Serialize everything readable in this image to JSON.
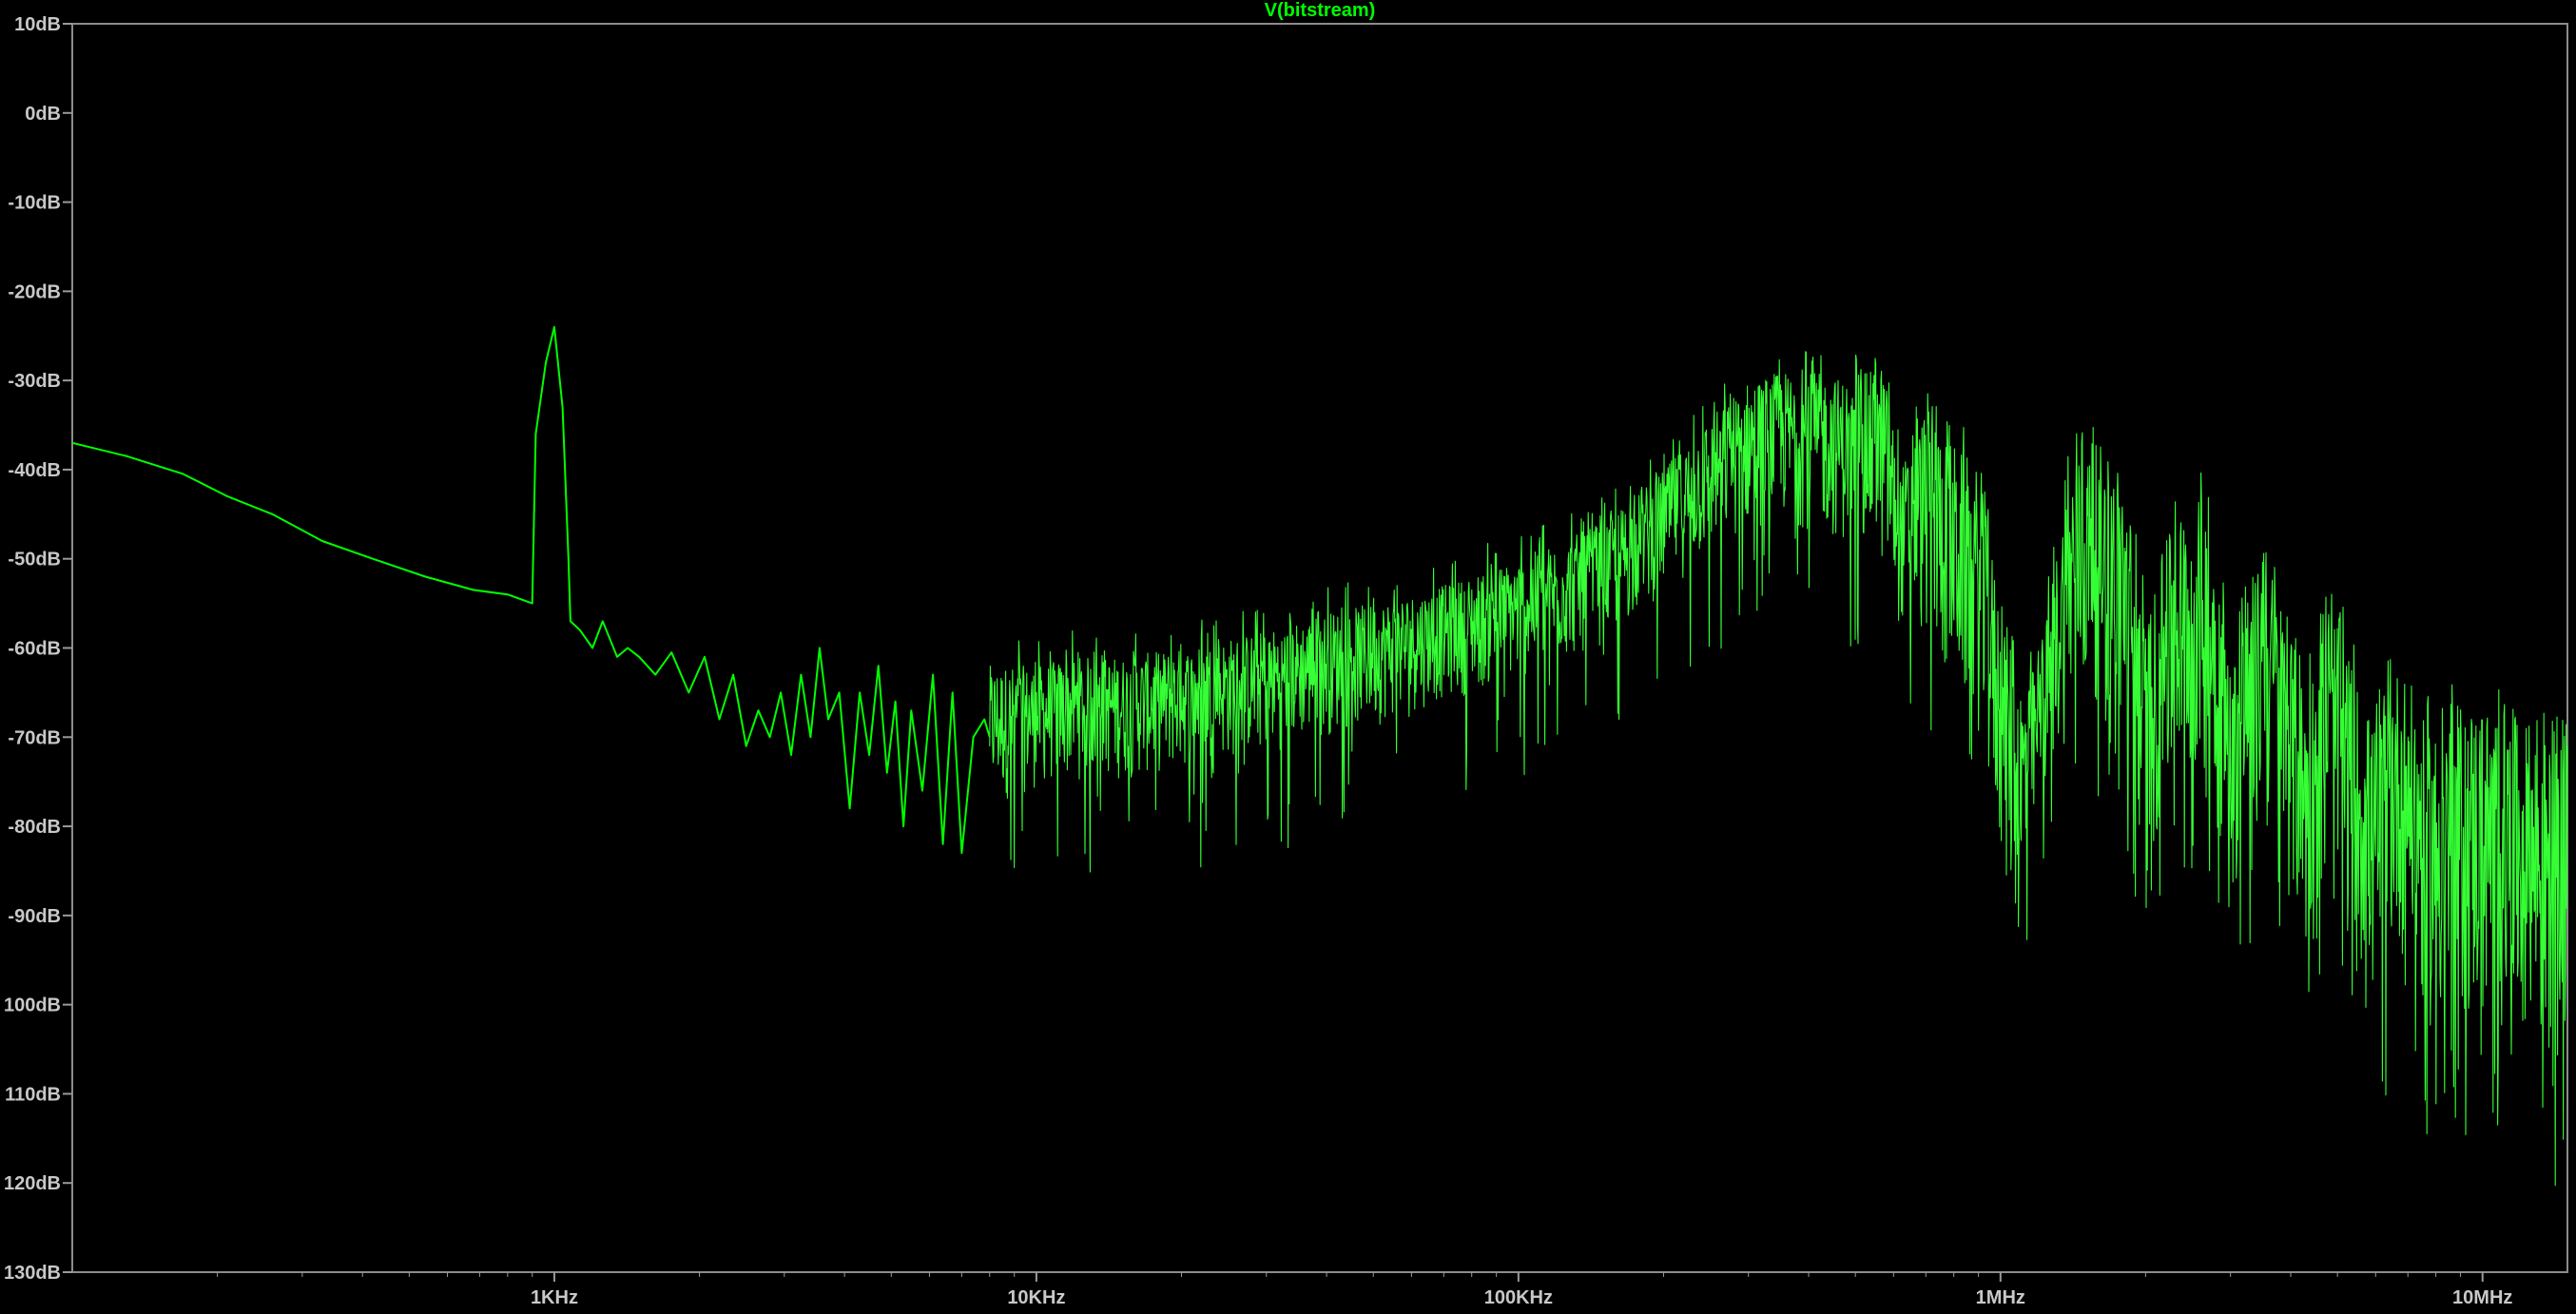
{
  "colors": {
    "background": "#000000",
    "frame": "#8c8c8c",
    "ticks": "#9a9a9a",
    "labels": "#c8c8c8",
    "trace": "#00ff00",
    "trace_fill": "#35ff35"
  },
  "chart_data": {
    "type": "line",
    "title": "V(bitstream)",
    "xlabel": "",
    "ylabel": "",
    "x_scale": "log",
    "xlim": [
      100,
      15000000
    ],
    "ylim": [
      -130,
      10
    ],
    "grid": false,
    "x_ticks": [
      {
        "value": 1000,
        "label": "1KHz"
      },
      {
        "value": 10000,
        "label": "10KHz"
      },
      {
        "value": 100000,
        "label": "100KHz"
      },
      {
        "value": 1000000,
        "label": "1MHz"
      },
      {
        "value": 10000000,
        "label": "10MHz"
      }
    ],
    "y_ticks": [
      {
        "value": 10,
        "label": "10dB"
      },
      {
        "value": 0,
        "label": "0dB"
      },
      {
        "value": -10,
        "label": "-10dB"
      },
      {
        "value": -20,
        "label": "-20dB"
      },
      {
        "value": -30,
        "label": "-30dB"
      },
      {
        "value": -40,
        "label": "-40dB"
      },
      {
        "value": -50,
        "label": "-50dB"
      },
      {
        "value": -60,
        "label": "-60dB"
      },
      {
        "value": -70,
        "label": "-70dB"
      },
      {
        "value": -80,
        "label": "-80dB"
      },
      {
        "value": -90,
        "label": "-90dB"
      },
      {
        "value": -100,
        "label": "100dB"
      },
      {
        "value": -110,
        "label": "110dB"
      },
      {
        "value": -120,
        "label": "120dB"
      },
      {
        "value": -130,
        "label": "130dB"
      }
    ],
    "series": [
      {
        "name": "V(bitstream)",
        "line_points": {
          "x": [
            100,
            130,
            170,
            210,
            260,
            330,
            420,
            540,
            680,
            800,
            900,
            915,
            960,
            1000,
            1040,
            1070,
            1080,
            1130,
            1200,
            1260,
            1350,
            1420,
            1500,
            1620,
            1750,
            1900,
            2050,
            2200,
            2350,
            2500,
            2650,
            2800,
            2950,
            3100,
            3250,
            3400,
            3550,
            3700,
            3900,
            4100,
            4300,
            4500,
            4700,
            4900,
            5100,
            5300,
            5500,
            5800,
            6100,
            6400,
            6700,
            7000,
            7400,
            7800
          ],
          "y": [
            -37,
            -38.5,
            -40.5,
            -43,
            -45,
            -48,
            -50,
            -52,
            -53.5,
            -54,
            -55,
            -36,
            -28,
            -24,
            -33,
            -50,
            -57,
            -58,
            -60,
            -57,
            -61,
            -60,
            -61,
            -63,
            -60.5,
            -65,
            -61,
            -68,
            -63,
            -71,
            -67,
            -70,
            -65,
            -72,
            -63,
            -70,
            -60,
            -68,
            -65,
            -78,
            -65,
            -72,
            -62,
            -74,
            -66,
            -80,
            -67,
            -76,
            -63,
            -82,
            -65,
            -83,
            -70,
            -68
          ]
        },
        "noise_band": {
          "x": [
            8000,
            10000,
            12000,
            15000,
            20000,
            30000,
            40000,
            50000,
            70000,
            100000,
            150000,
            200000,
            250000,
            300000,
            350000,
            400000,
            500000,
            570000,
            620000,
            700000,
            800000,
            900000,
            1000000,
            1100000,
            1200000,
            1400000,
            1600000,
            1800000,
            2000000,
            2300000,
            2600000,
            2800000,
            3000000,
            3300000,
            3600000,
            3900000,
            4300000,
            4700000,
            5000000,
            5500000,
            6000000,
            6500000,
            7000000,
            7500000,
            8000000,
            9000000,
            10000000,
            12000000,
            14000000,
            15000000
          ],
          "upper": [
            -62,
            -62,
            -61,
            -61,
            -60,
            -58,
            -56,
            -55,
            -53,
            -50,
            -46,
            -40,
            -34,
            -30,
            -29,
            -29,
            -30,
            -28,
            -40,
            -33,
            -37,
            -40,
            -55,
            -63,
            -62,
            -39,
            -37,
            -40,
            -57,
            -45,
            -43,
            -47,
            -62,
            -52,
            -50,
            -56,
            -65,
            -57,
            -56,
            -64,
            -69,
            -62,
            -63,
            -68,
            -69,
            -66,
            -66,
            -68,
            -71,
            -70
          ],
          "lower": [
            -78,
            -76,
            -75,
            -75,
            -74,
            -72,
            -70,
            -69,
            -66,
            -64,
            -60,
            -54,
            -50,
            -47,
            -46,
            -47,
            -49,
            -52,
            -58,
            -60,
            -66,
            -70,
            -85,
            -95,
            -78,
            -69,
            -66,
            -72,
            -87,
            -77,
            -76,
            -81,
            -90,
            -82,
            -83,
            -87,
            -96,
            -90,
            -91,
            -97,
            -103,
            -95,
            -95,
            -102,
            -104,
            -103,
            -104,
            -106,
            -110,
            -112
          ]
        }
      }
    ]
  }
}
